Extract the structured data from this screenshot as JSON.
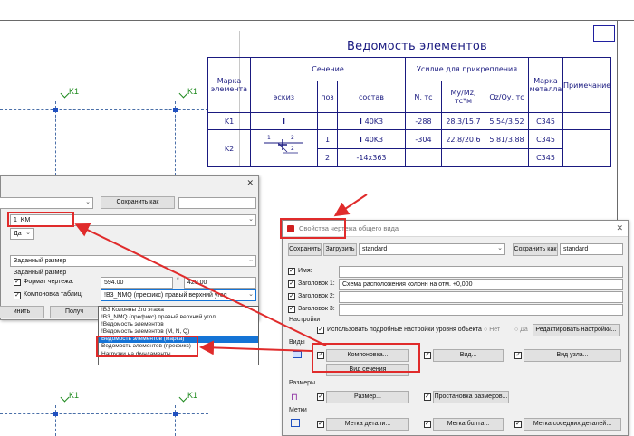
{
  "drawing": {
    "title": "Ведомость элементов",
    "axis_label": "K1",
    "table": {
      "header": {
        "mark": "Марка элемента",
        "section": "Сечение",
        "sketch": "эскиз",
        "pos": "поз",
        "composition": "состав",
        "force": "Усилие для прикрепления",
        "n": "N, тс",
        "my": "My/Mz, тс*м",
        "qz": "Qz/Qy, тс",
        "steel": "Марка металла",
        "note": "Примечание"
      },
      "rows": [
        {
          "mark": "K1",
          "pos": "",
          "comp": "40K3",
          "n": "-288",
          "m": "28.3/15.7",
          "q": "5.54/3.52",
          "steel": "C345"
        },
        {
          "mark": "K2",
          "pos": "1",
          "comp": "40K3",
          "n": "-304",
          "m": "22.8/20.6",
          "q": "5.81/3.88",
          "steel": "C345"
        },
        {
          "mark": "",
          "pos": "2",
          "comp": "-14x363",
          "n": "",
          "m": "",
          "q": "",
          "steel": "C345"
        }
      ],
      "sketch_labels": [
        "1",
        "2",
        "2"
      ]
    }
  },
  "left_dialog": {
    "save_as_label": "Сохранить как",
    "name_value": "1_KM",
    "yes_value": "Да",
    "size_mode_value": "Заданный размер",
    "group_label": "Заданный размер",
    "format_label": "Формат чертежа:",
    "width_value": "594.00",
    "times": "*",
    "height_value": "420.00",
    "layout_label": "Компоновка таблиц:",
    "layout_value": "!B3_NMQ (префикс) правый верхний угол",
    "apply_label": "инить",
    "get_label": "Получ",
    "options": [
      "!B3 Колонны 2го этажа",
      "!B3_NMQ (префикс) правый верхний угол",
      "!Ведомость элементов",
      "!Ведомость элементов (М, N, Q)",
      "Ведомость элементов (марка)",
      "Ведомость элементов (префикс)",
      "Нагрузки на фундаменты"
    ],
    "selected_option": 4
  },
  "right_dialog": {
    "title": "Свойства чертежа общего вида",
    "save": "Сохранить",
    "load": "Загрузить",
    "preset": "standard",
    "save_as": "Сохранить как",
    "save_as_value": "standard",
    "name_label": "Имя:",
    "heading1_label": "Заголовок 1:",
    "heading1_value": "Схема расположения колонн на отм. +0,000",
    "heading2_label": "Заголовок 2:",
    "heading3_label": "Заголовок 3:",
    "settings_section": "Настройки",
    "detailed_settings": "Использовать подробные настройки уровня объекта",
    "no_label": "Нет",
    "yes_label": "Да",
    "edit_settings": "Редактировать настройки...",
    "views_section": "Виды",
    "layout_btn": "Компоновка...",
    "view_btn": "Вид...",
    "node_view_btn": "Вид узла...",
    "section_view_btn": "Вид сечения",
    "dimensions_section": "Размеры",
    "size_btn": "Размер...",
    "dim_placement_btn": "Простановка размеров...",
    "marks_section": "Метки",
    "part_mark_btn": "Метка детали...",
    "bolt_mark_btn": "Метка болта...",
    "neighbor_mark_btn": "Метка соседних деталей..."
  },
  "colors": {
    "annotation": "#e02b2b",
    "drawing_ink": "#1a1a80",
    "axis": "#1e8a1e",
    "selection": "#1574d6"
  }
}
